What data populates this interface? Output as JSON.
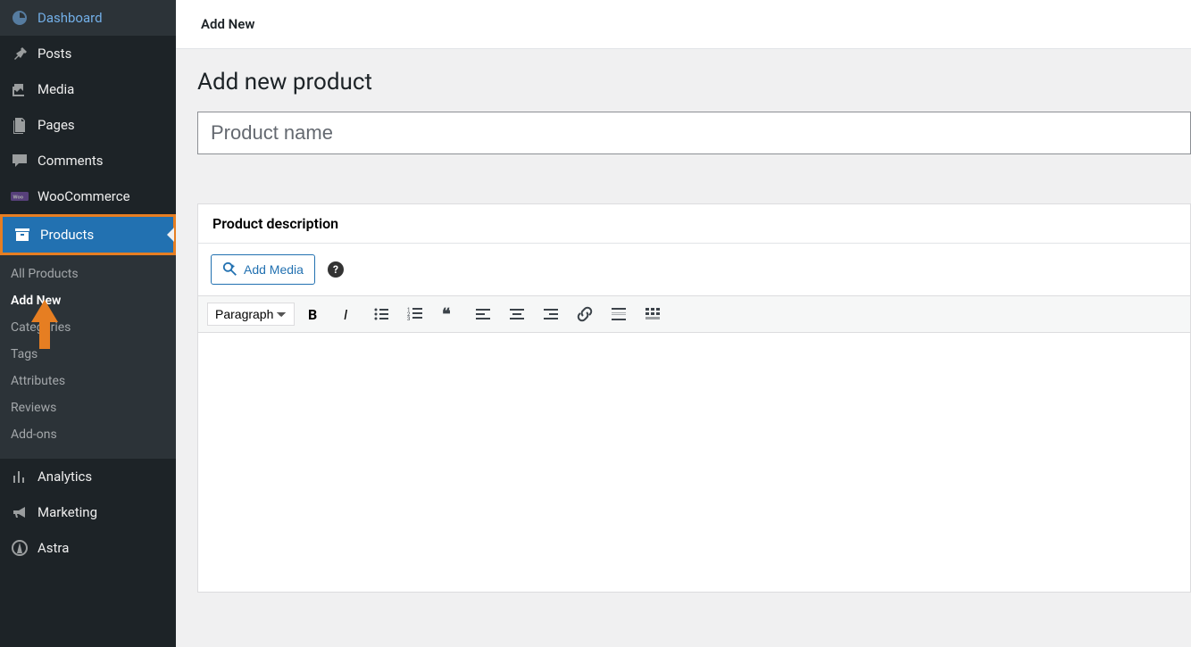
{
  "sidebar": {
    "items": [
      {
        "label": "Dashboard"
      },
      {
        "label": "Posts"
      },
      {
        "label": "Media"
      },
      {
        "label": "Pages"
      },
      {
        "label": "Comments"
      },
      {
        "label": "WooCommerce"
      },
      {
        "label": "Products"
      },
      {
        "label": "Analytics"
      },
      {
        "label": "Marketing"
      },
      {
        "label": "Astra"
      }
    ],
    "submenu": [
      {
        "label": "All Products"
      },
      {
        "label": "Add New"
      },
      {
        "label": "Categories"
      },
      {
        "label": "Tags"
      },
      {
        "label": "Attributes"
      },
      {
        "label": "Reviews"
      },
      {
        "label": "Add-ons"
      }
    ]
  },
  "header": {
    "title": "Add New"
  },
  "main": {
    "page_title": "Add new product",
    "product_name_placeholder": "Product name",
    "description_label": "Product description",
    "add_media_label": "Add Media",
    "format_select": "Paragraph"
  }
}
